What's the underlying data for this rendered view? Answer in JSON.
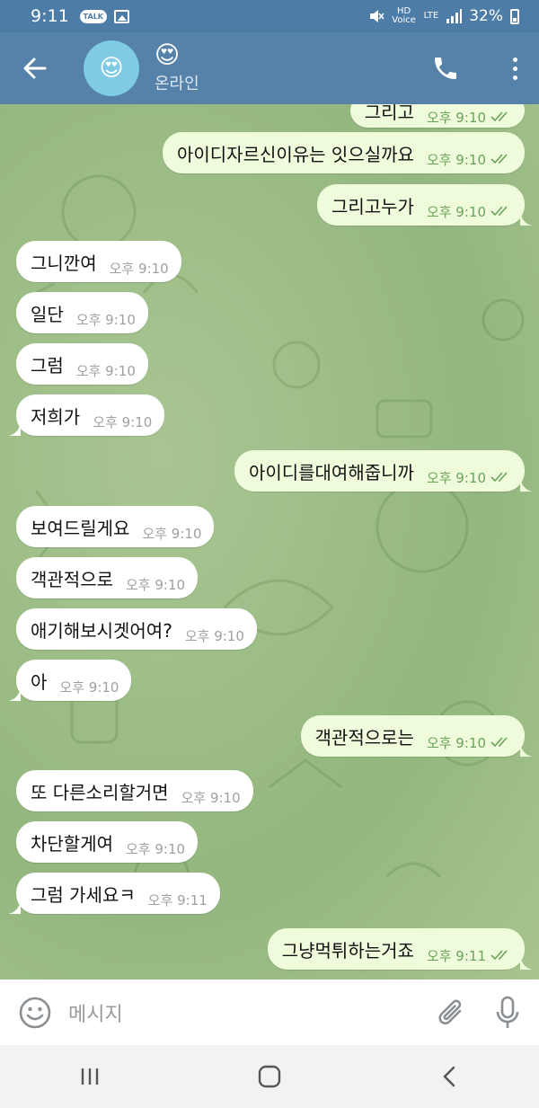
{
  "status_bar": {
    "time": "9:11",
    "talk_badge": "TALK",
    "volte": "HD Voice",
    "network": "LTE",
    "battery": "32%"
  },
  "header": {
    "title_emoji": "😍",
    "avatar_emoji": "😍",
    "status": "온라인",
    "bg_color": "#5682a9"
  },
  "messages": [
    {
      "dir": "out",
      "text": "그리고",
      "time": "오후 9:10"
    },
    {
      "dir": "out",
      "text": "아이디자르신이유는 잇으실까요",
      "time": "오후 9:10"
    },
    {
      "dir": "out",
      "text": "그리고누가",
      "time": "오후 9:10"
    },
    {
      "dir": "in",
      "text": "그니깐여",
      "time": "오후 9:10"
    },
    {
      "dir": "in",
      "text": "일단",
      "time": "오후 9:10"
    },
    {
      "dir": "in",
      "text": "그럼",
      "time": "오후 9:10"
    },
    {
      "dir": "in",
      "text": "저희가",
      "time": "오후 9:10"
    },
    {
      "dir": "out",
      "text": "아이디를대여해줍니까",
      "time": "오후 9:10"
    },
    {
      "dir": "in",
      "text": "보여드릴게요",
      "time": "오후 9:10"
    },
    {
      "dir": "in",
      "text": "객관적으로",
      "time": "오후 9:10"
    },
    {
      "dir": "in",
      "text": "애기해보시겟어여?",
      "time": "오후 9:10"
    },
    {
      "dir": "in",
      "text": "아",
      "time": "오후 9:10"
    },
    {
      "dir": "out",
      "text": "객관적으로는",
      "time": "오후 9:10"
    },
    {
      "dir": "in",
      "text": "또 다른소리할거면",
      "time": "오후 9:10"
    },
    {
      "dir": "in",
      "text": "차단할게여",
      "time": "오후 9:10"
    },
    {
      "dir": "in",
      "text": "그럼 가세요ㅋ",
      "time": "오후 9:11"
    },
    {
      "dir": "out",
      "text": "그냥먹튀하는거죠",
      "time": "오후 9:11"
    }
  ],
  "input": {
    "placeholder": "메시지"
  },
  "colors": {
    "outgoing_bubble": "#effcdc",
    "incoming_bubble": "#ffffff",
    "read_check": "#6ba35a"
  }
}
